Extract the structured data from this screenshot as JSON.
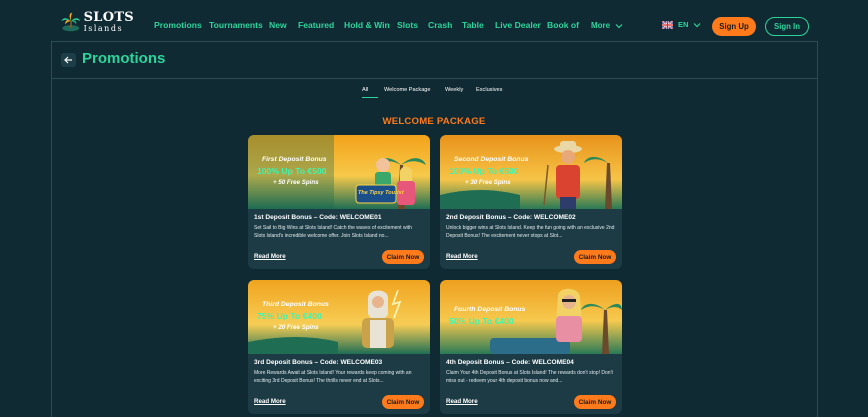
{
  "brand": {
    "line1": "SLOTS",
    "line2": "Islands"
  },
  "nav": {
    "items": [
      {
        "label": "Promotions"
      },
      {
        "label": "Tournaments"
      },
      {
        "label": "New"
      },
      {
        "label": "Featured"
      },
      {
        "label": "Hold & Win"
      },
      {
        "label": "Slots"
      },
      {
        "label": "Crash"
      },
      {
        "label": "Table"
      },
      {
        "label": "Live Dealer"
      },
      {
        "label": "Book of"
      }
    ],
    "more_label": "More"
  },
  "language": {
    "code": "EN",
    "icon": "uk-flag-icon"
  },
  "auth": {
    "signup_label": "Sign Up",
    "signin_label": "Sign In"
  },
  "page": {
    "title": "Promotions"
  },
  "tabs": [
    {
      "label": "All",
      "active": true
    },
    {
      "label": "Welcome Package",
      "active": false
    },
    {
      "label": "Weekly",
      "active": false
    },
    {
      "label": "Exclusives",
      "active": false
    }
  ],
  "section": {
    "title": "WELCOME PACKAGE"
  },
  "cards": [
    {
      "img_line1": "First Deposit Bonus",
      "img_line2": "100% Up To €500",
      "img_line3": "+ 50 Free Spins",
      "img_logo": "The Tipsy Tourist",
      "title": "1st Deposit Bonus – Code: WELCOME01",
      "description": "Set Sail to Big Wins at Slots Island! Catch the waves of excitement with Slots Island's incredible welcome offer. Join Slots Island no...",
      "read_more": "Read More",
      "claim": "Claim Now"
    },
    {
      "img_line1": "Second Deposit Bonus",
      "img_line2": "100% Up To €500",
      "img_line3": "+ 30 Free Spins",
      "title": "2nd Deposit Bonus – Code: WELCOME02",
      "description": "Unlock bigger wins at Slots Island. Keep the fun going with an exclusive 2nd Deposit Bonus! The excitement never stops at Slot...",
      "read_more": "Read More",
      "claim": "Claim Now"
    },
    {
      "img_line1": "Third Deposit Bonus",
      "img_line2": "75% Up To €400",
      "img_line3": "+ 20 Free Spins",
      "title": "3rd Deposit Bonus – Code: WELCOME03",
      "description": "More Rewards Await at Slots Island! Your rewards keep coming with an exciting 3rd Deposit Bonus! The thrills never end at Slots...",
      "read_more": "Read More",
      "claim": "Claim Now"
    },
    {
      "img_line1": "Fourth Deposit Bonus",
      "img_line2": "50% Up To €400",
      "img_line3": "",
      "title": "4th Deposit Bonus – Code: WELCOME04",
      "description": "Claim Your 4th Deposit Bonus at Slots Island! The rewards don't stop! Don't miss out - redeem your 4th deposit bonus now and...",
      "read_more": "Read More",
      "claim": "Claim Now"
    }
  ],
  "colors": {
    "background": "#102a33",
    "accent_green": "#2ed39b",
    "accent_orange": "#ff7a1a",
    "card_bg": "#1d3b45"
  }
}
